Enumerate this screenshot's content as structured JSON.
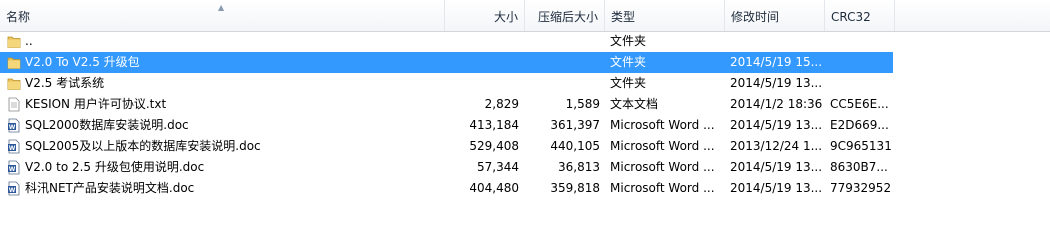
{
  "columns": {
    "name": "名称",
    "size": "大小",
    "compressed": "压缩后大小",
    "type": "类型",
    "modified": "修改时间",
    "crc": "CRC32"
  },
  "rows": [
    {
      "name": "..",
      "size": "",
      "compressed": "",
      "type": "文件夹",
      "modified": "",
      "crc": "",
      "icon": "folder-icon",
      "selected": false
    },
    {
      "name": "V2.0 To V2.5 升级包",
      "size": "",
      "compressed": "",
      "type": "文件夹",
      "modified": "2014/5/19 15...",
      "crc": "",
      "icon": "folder-icon",
      "selected": true
    },
    {
      "name": "V2.5 考试系统",
      "size": "",
      "compressed": "",
      "type": "文件夹",
      "modified": "2014/5/19 13...",
      "crc": "",
      "icon": "folder-icon",
      "selected": false
    },
    {
      "name": "KESION 用户许可协议.txt",
      "size": "2,829",
      "compressed": "1,589",
      "type": "文本文档",
      "modified": "2014/1/2 18:36",
      "crc": "CC5E6E...",
      "icon": "text-file-icon",
      "selected": false
    },
    {
      "name": "SQL2000数据库安装说明.doc",
      "size": "413,184",
      "compressed": "361,397",
      "type": "Microsoft Word ...",
      "modified": "2014/5/19 13...",
      "crc": "E2D669...",
      "icon": "word-doc-icon",
      "selected": false
    },
    {
      "name": "SQL2005及以上版本的数据库安装说明.doc",
      "size": "529,408",
      "compressed": "440,105",
      "type": "Microsoft Word ...",
      "modified": "2013/12/24 1...",
      "crc": "9C965131",
      "icon": "word-doc-icon",
      "selected": false
    },
    {
      "name": "V2.0 to 2.5 升级包使用说明.doc",
      "size": "57,344",
      "compressed": "36,813",
      "type": "Microsoft Word ...",
      "modified": "2014/5/19 13...",
      "crc": "8630B7...",
      "icon": "word-doc-icon",
      "selected": false
    },
    {
      "name": "科汛NET产品安装说明文档.doc",
      "size": "404,480",
      "compressed": "359,818",
      "type": "Microsoft Word ...",
      "modified": "2014/5/19 13...",
      "crc": "77932952",
      "icon": "word-doc-icon",
      "selected": false
    }
  ],
  "colors": {
    "selection": "#3399ff",
    "folder": "#e8c25a",
    "word": "#2b579a"
  }
}
